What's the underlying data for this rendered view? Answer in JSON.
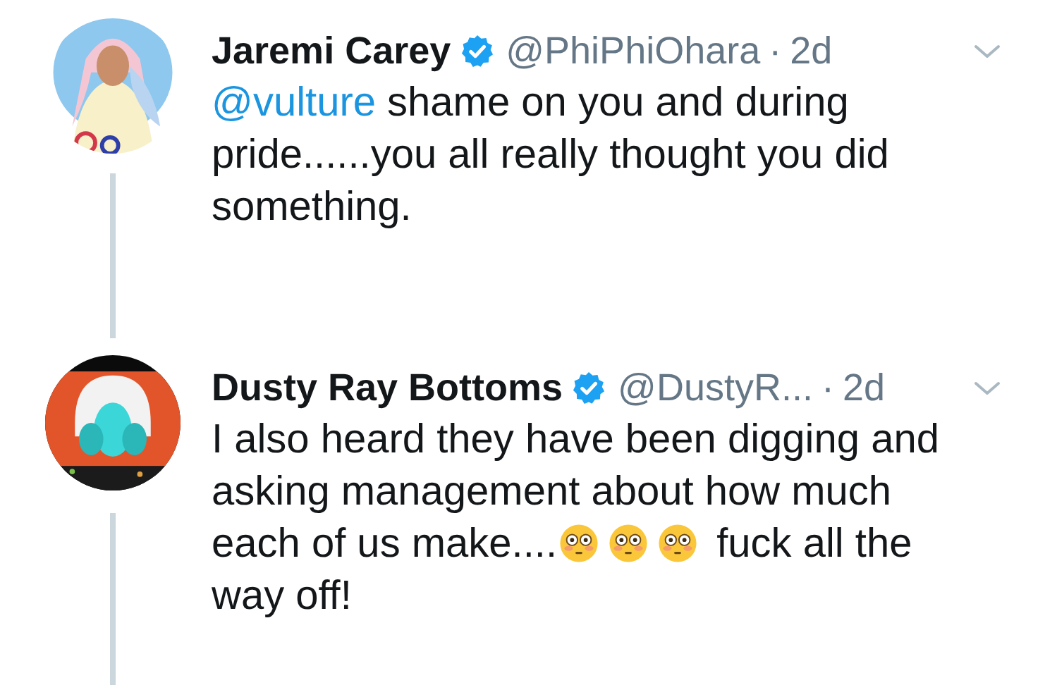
{
  "tweets": [
    {
      "name": "Jaremi Carey",
      "verified": true,
      "handle": "@PhiPhiOhara",
      "separator": "·",
      "time": "2d",
      "thread_line": true,
      "body": [
        {
          "kind": "mention",
          "text": "@vulture"
        },
        {
          "kind": "text",
          "text": " shame on you and during pride......you all really thought you did something."
        }
      ]
    },
    {
      "name": "Dusty Ray Bottoms",
      "verified": true,
      "handle": "@DustyR...",
      "separator": "·",
      "time": "2d",
      "thread_line": true,
      "body": [
        {
          "kind": "text",
          "text": "I also heard they have been digging and asking management about how much each of us make...."
        },
        {
          "kind": "emoji"
        },
        {
          "kind": "emoji"
        },
        {
          "kind": "emoji"
        },
        {
          "kind": "text",
          "text": "  fuck all the way off!"
        }
      ]
    }
  ]
}
